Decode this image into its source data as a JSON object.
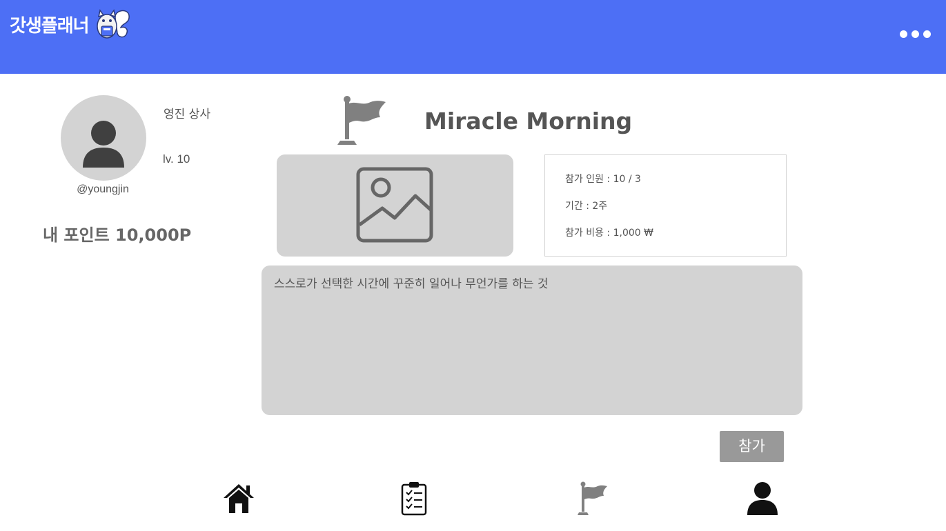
{
  "header": {
    "app_title": "갓생플래너",
    "brand_color": "#4d6ff5",
    "mascot_icon": "squirrel-mascot-icon",
    "more_icon": "more-horizontal-icon"
  },
  "profile": {
    "avatar_icon": "user-avatar-icon",
    "handle": "@youngjin",
    "name": "영진 상사",
    "level": "lv. 10",
    "points_label": "내 포인트 10,000P"
  },
  "challenge": {
    "flag_icon": "flag-icon",
    "title": "Miracle Morning",
    "image_icon": "image-placeholder-icon",
    "info": {
      "participants": "참가 인원 : 10 / 3",
      "period": "기간 : 2주",
      "fee": "참가 비용 : 1,000 ₩"
    },
    "description": "스스로가 선택한 시간에 꾸준히 일어나 무언가를 하는 것",
    "join_label": "참가"
  },
  "bottom_nav": {
    "items": [
      {
        "name": "home",
        "icon": "home-icon"
      },
      {
        "name": "todo",
        "icon": "clipboard-checklist-icon"
      },
      {
        "name": "challenge",
        "icon": "flag-icon"
      },
      {
        "name": "my-page",
        "icon": "user-icon"
      }
    ]
  }
}
